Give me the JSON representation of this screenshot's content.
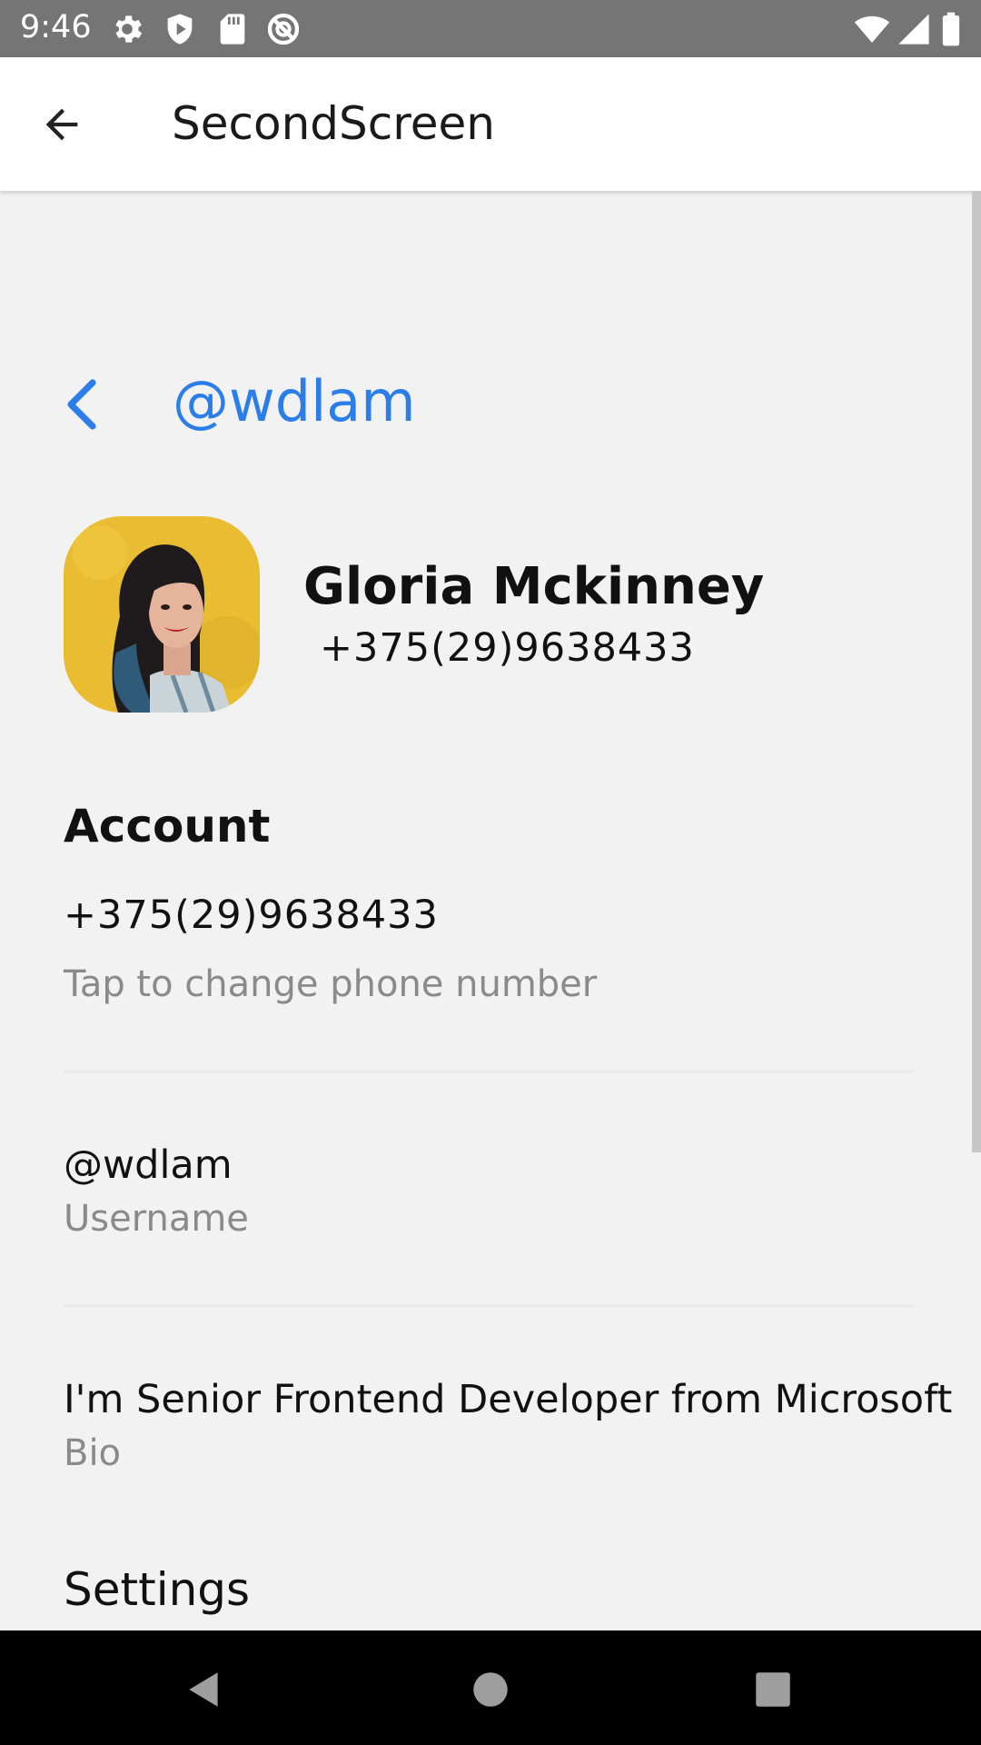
{
  "status_bar": {
    "time": "9:46",
    "left_icons": [
      "gear-icon",
      "shield-icon",
      "sd-card-icon",
      "no-disturb-icon"
    ],
    "right_icons": [
      "wifi-icon",
      "signal-icon",
      "battery-icon"
    ]
  },
  "app_bar": {
    "title": "SecondScreen",
    "back_icon": "arrow-left-icon"
  },
  "profile_header": {
    "handle": "@wdlam",
    "back_icon": "chevron-left-icon",
    "accent_color": "#2b7de9"
  },
  "profile": {
    "name": "Gloria Mckinney",
    "phone": "+375(29)9638433",
    "avatar": "avatar-photo"
  },
  "account": {
    "section_title": "Account",
    "phone_value": "+375(29)9638433",
    "phone_hint": "Tap to change phone number",
    "username_value": "@wdlam",
    "username_hint": "Username",
    "bio_value": "I'm Senior Frontend Developer from Microsoft",
    "bio_hint": "Bio"
  },
  "settings": {
    "section_title": "Settings"
  },
  "nav_bar": {
    "buttons": [
      "back-triangle-icon",
      "home-circle-icon",
      "recents-square-icon"
    ]
  }
}
